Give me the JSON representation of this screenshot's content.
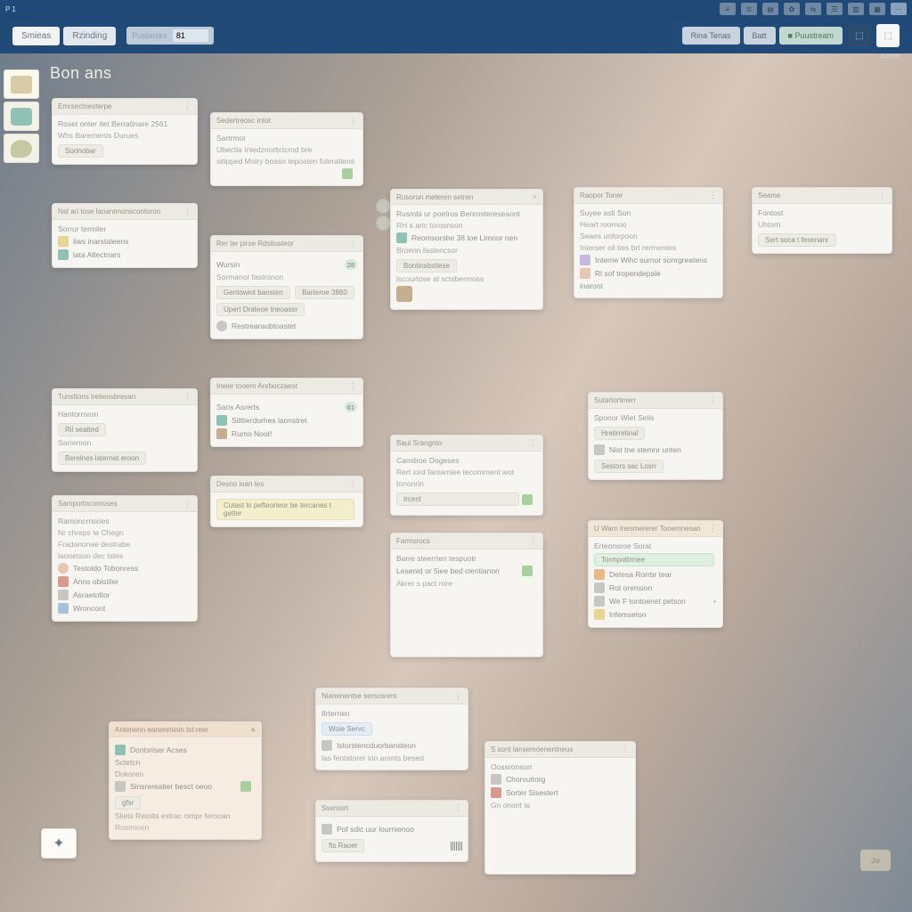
{
  "topbar": {
    "left": "P 1",
    "right_label": "menu"
  },
  "menubar": {
    "tab1": "Smieas",
    "tab2": "Rzinding",
    "field_label": "Pustanies",
    "field_value": "81",
    "btn_feature": "Rina Tenas",
    "btn_mid": "Batt",
    "btn_accent": "Puustream",
    "sublabel": "d crem"
  },
  "board": {
    "title": "Bon ans"
  },
  "rail": {
    "items": [
      "box-icon",
      "cash-icon",
      "leaf-icon"
    ]
  },
  "fab": {
    "glyph": "✦"
  },
  "corner": {
    "label": "Jsi"
  },
  "cards": {
    "c1": {
      "title": "Emrsectnesterpe",
      "l1": "Roset onter itet Berratinare 2561",
      "l2": "Whs Barements Durues",
      "chip": "Sorinobar"
    },
    "c2": {
      "title": "Nst ari tose laoantmonscontoroo",
      "l1": "Sorrur termiler",
      "r1": "iiws inarstaleens",
      "r2": "lata Altectnars"
    },
    "c3": {
      "title": "Tunsttons lretieosbresan",
      "l1": "Hantorroron",
      "chip1": "Ril seatted",
      "l2": "Sarremon",
      "chip2": "Berelnes laternat eroon"
    },
    "c4": {
      "title": "Samportncomoses",
      "l1": "Ramoncrnories",
      "l2": "Nr chreps te Chegn",
      "l3": "Fradanonae destrabe",
      "l4": "laonetson dec tstes",
      "r1": "Testoldo Tobonress",
      "r2": "Anns obistiler",
      "r3": "Asraetottor",
      "r4": "Wroncont"
    },
    "c5": {
      "title": "Sedertreosc Intot",
      "l1": "Sartrmor",
      "l2": "Ubectia Iniedznorbrtcrod bre",
      "l3": "sitipped Mstry boasn tepoaten fuleratiens",
      "icon": "grn"
    },
    "c6": {
      "title": "Rer ter pirse Rdstiusteor",
      "l1": "Wursin",
      "badge": "28",
      "l2": "Sormanor fastronon",
      "chip1": "Gentowiot bansten",
      "chip2": "Barteroe 3860",
      "chip3": "Upert Drateoe tneoassr",
      "r1": "Restrearaubtoastet"
    },
    "c7": {
      "title": "Inwer tooern Anrboczaest",
      "l1": "Sans Asrerts",
      "badge": "61",
      "r1": "Silttierdorhes laonstret",
      "r2": "Rumo Noot!"
    },
    "c8": {
      "title": "Desno ioan tes",
      "chip": "Cutast lo pefteorteor be tercanes t getter"
    },
    "c9": {
      "title": "Rusorun meteren setren",
      "l1": "Rusmbi ur poetros Benrostereseaont",
      "l2": "RH s aric torosnson",
      "r1": "Reomsorsbe 38 toe Limnor nen",
      "l3": "Broenn fastencsor",
      "chip": "Bontinsbstiese",
      "l4": "lscourtose at sctsbermoss"
    },
    "c10": {
      "title": "Baut Srangnto",
      "l1": "Camitroe Dogeses",
      "l2": "Rert iord fantamlee tecomment wot",
      "l3": "tononrin",
      "chip": "Ircent",
      "icon": "grn"
    },
    "c11": {
      "title": "Farmsrocs",
      "l1": "Barre steerrten tespuotr",
      "l2": "Lesenid or 5iee bed cientianon",
      "l3": "Akrer s pact rore",
      "icon": "grn"
    },
    "c12": {
      "title": "Raopor Toner",
      "l1": "Suyee asti Son",
      "l2": "Heart roornoo",
      "l3": "Seaes unforpoon",
      "l4": "Interser oil ties brt rermentes",
      "r1": "Interne Wihc surnor sonrgreatens",
      "r2": "Rl sof tropendepale",
      "link": "inaront"
    },
    "c13": {
      "title": "Seame",
      "l1": "Fontost",
      "l2": "Uhtorn",
      "chip": "Sert soca t fesenanr"
    },
    "c14": {
      "title": "Sutartortmerr",
      "l1": "Sponor Wiet Selis",
      "chip1": "Hretirretinal",
      "r1": "Nist tne stemnr unten",
      "chip2": "Sestors sac Losrr"
    },
    "c15": {
      "title": "U Warn lnesmererer Tooemnesan",
      "l1": "Erteonsroe Sorat",
      "chip": "Tormpottnnee",
      "r1": "Detesa Rorrbr tear",
      "r2": "Rot orension",
      "r3": "We F tontoenet petson",
      "r4": "lnfemseton",
      "plus": "+"
    },
    "c16": {
      "title": "Antenenn eanenminin tst reer",
      "r1": "Dontsriser Acses",
      "l1": "Sctetcn",
      "l2": "Dokoren",
      "r2": "Sinsrereatier besct oeoo",
      "chip": "gfsr",
      "l3": "Sliets Retolts extrac cimpr ferooan",
      "foot": "Rosminen"
    },
    "c17": {
      "title": "Nianenentse sersosrem",
      "l1": "8rternen",
      "chip": "Woie Servc",
      "r1": "Istorstencduorbansteon",
      "l2": "las fentatorer ion arents besed"
    },
    "c18": {
      "title": "Ssentort",
      "r1": "Pof sdic uur lournienoo",
      "chip": "fts Raoer",
      "icon": "barcode"
    },
    "c19": {
      "title": "S sont lansemoenentneus",
      "l1": "Oossronsurr",
      "r1": "Chorvuttorg",
      "r2": "Sorter Sisestert",
      "l2": "Gn onont ia"
    }
  }
}
